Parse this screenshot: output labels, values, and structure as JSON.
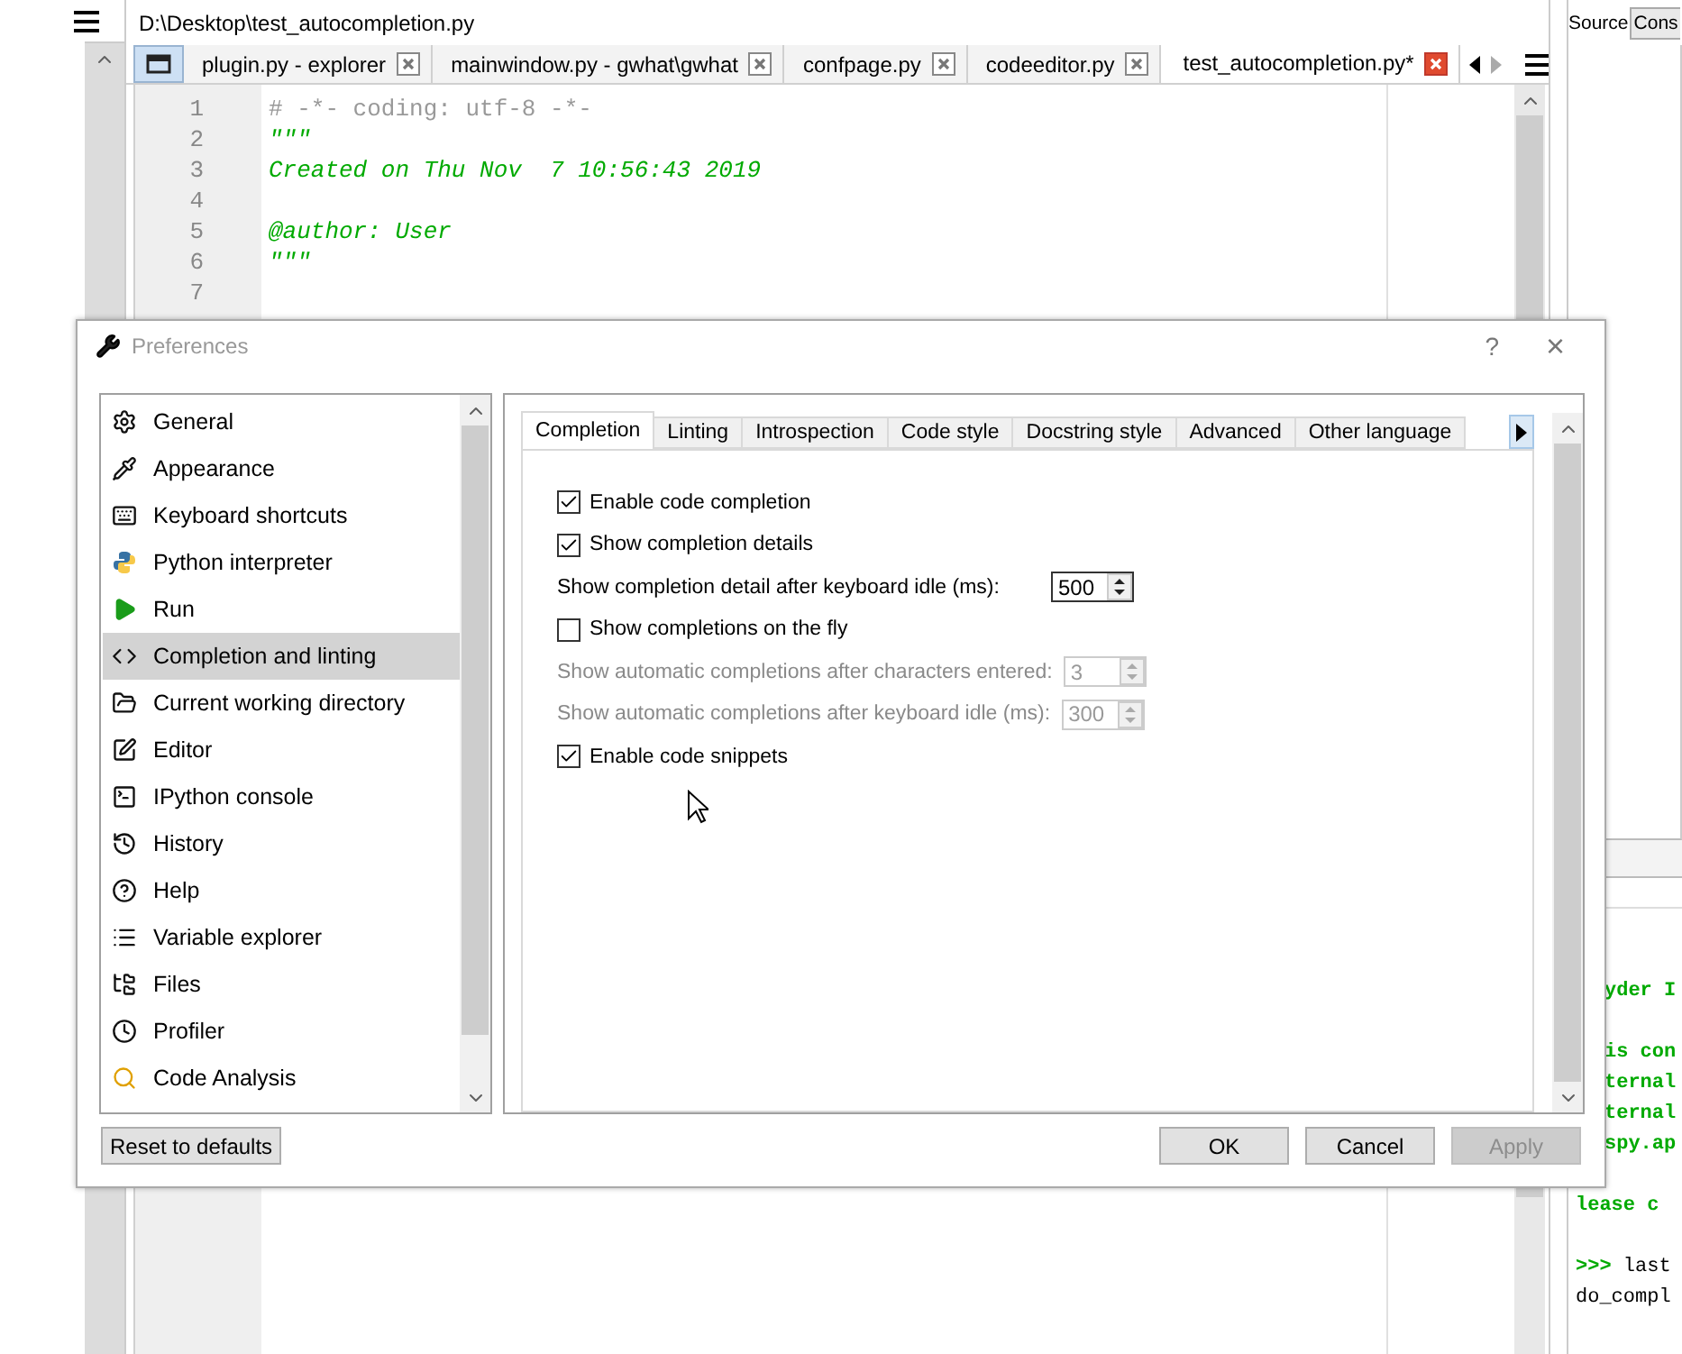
{
  "main_window": {
    "file_path": "D:\\Desktop\\test_autocompletion.py",
    "editor_tabs": [
      {
        "label": "plugin.py - explorer",
        "selected": false
      },
      {
        "label": "mainwindow.py - gwhat\\gwhat",
        "selected": false
      },
      {
        "label": "confpage.py",
        "selected": false
      },
      {
        "label": "codeeditor.py",
        "selected": false
      },
      {
        "label": "test_autocompletion.py*",
        "selected": true
      }
    ],
    "code_lines": [
      {
        "number": "1",
        "text": "# -*- coding: utf-8 -*-",
        "kind": "comment"
      },
      {
        "number": "2",
        "text": "\"\"\"",
        "kind": "string"
      },
      {
        "number": "3",
        "text": "Created on Thu Nov  7 10:56:43 2019",
        "kind": "string"
      },
      {
        "number": "4"
      },
      {
        "number": "5",
        "text": "@author: User",
        "kind": "string"
      },
      {
        "number": "6",
        "text": "\"\"\"",
        "kind": "string"
      },
      {
        "number": "7"
      }
    ],
    "source_label": "Source",
    "console_select": "Cons",
    "console_blocks": [
      {
        "lines": [
          {
            "text": "yder I",
            "kind": "cut-output"
          }
        ]
      },
      {
        "lines": [
          {
            "text": "is con",
            "kind": "cut-output"
          },
          {
            "text": "ternal",
            "kind": "cut-output"
          },
          {
            "text": "ternal",
            "kind": "cut-output"
          },
          {
            "text": "spy.ap",
            "kind": "cut-output"
          }
        ]
      },
      {
        "lines": [
          {
            "text": "lease c",
            "kind": "output"
          }
        ]
      },
      {
        "lines": [
          {
            "prompt": ">>>",
            "text": " last",
            "kind": "input"
          },
          {
            "text": "do_compl",
            "kind": "input"
          }
        ]
      }
    ]
  },
  "dialog": {
    "title": "Preferences",
    "help": "?",
    "close": "×",
    "pages": [
      {
        "label": "General",
        "selected": false
      },
      {
        "label": "Appearance",
        "selected": false
      },
      {
        "label": "Keyboard shortcuts",
        "selected": false
      },
      {
        "label": "Python interpreter",
        "selected": false
      },
      {
        "label": "Run",
        "selected": false
      },
      {
        "label": "Completion and linting",
        "selected": true
      },
      {
        "label": "Current working directory",
        "selected": false
      },
      {
        "label": "Editor",
        "selected": false
      },
      {
        "label": "IPython console",
        "selected": false
      },
      {
        "label": "History",
        "selected": false
      },
      {
        "label": "Help",
        "selected": false
      },
      {
        "label": "Variable explorer",
        "selected": false
      },
      {
        "label": "Files",
        "selected": false
      },
      {
        "label": "Profiler",
        "selected": false
      },
      {
        "label": "Code Analysis",
        "selected": false
      }
    ],
    "tabs": [
      {
        "label": "Completion",
        "selected": true
      },
      {
        "label": "Linting",
        "selected": false
      },
      {
        "label": "Introspection",
        "selected": false
      },
      {
        "label": "Code style",
        "selected": false
      },
      {
        "label": "Docstring style",
        "selected": false
      },
      {
        "label": "Advanced",
        "selected": false
      },
      {
        "label": "Other language",
        "selected": false
      }
    ],
    "options": [
      {
        "kind": "checkbox",
        "label": "Enable code completion",
        "checked": true
      },
      {
        "kind": "checkbox",
        "label": "Show completion details",
        "checked": true
      },
      {
        "kind": "spin",
        "label": "Show completion detail after keyboard idle (ms):",
        "value": "500",
        "disabled": false
      },
      {
        "kind": "checkbox",
        "label": "Show completions on the fly",
        "checked": false
      },
      {
        "kind": "spin",
        "label": "Show automatic completions after characters entered:",
        "value": "3",
        "disabled": true
      },
      {
        "kind": "spin",
        "label": "Show automatic completions after keyboard idle (ms):",
        "value": "300",
        "disabled": true
      },
      {
        "kind": "checkbox",
        "label": "Enable code snippets",
        "checked": true
      }
    ],
    "reset_button": "Reset to defaults",
    "buttons": [
      {
        "label": "OK",
        "disabled": false
      },
      {
        "label": "Cancel",
        "disabled": false
      },
      {
        "label": "Apply",
        "disabled": true
      }
    ]
  }
}
